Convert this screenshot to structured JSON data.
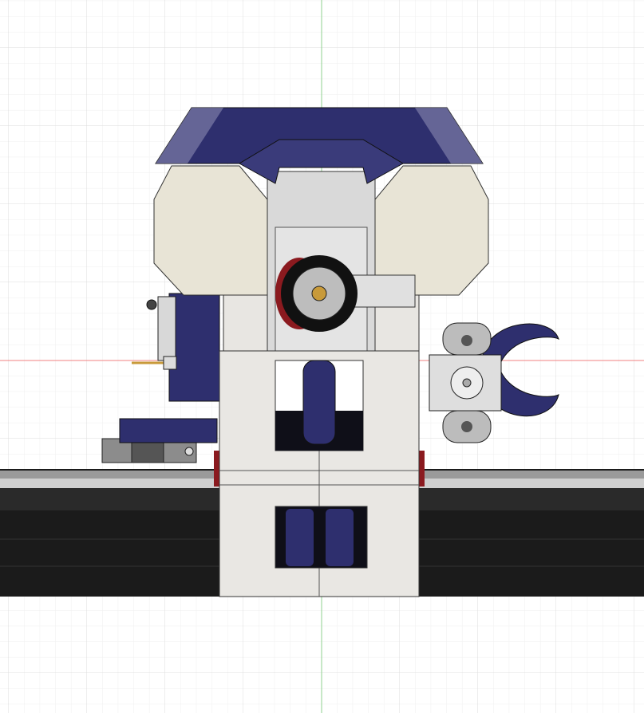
{
  "viewport": {
    "view": "front",
    "background_color": "#ffffff",
    "grid_color": "#e3e3e3",
    "x_axis_color": "#f08080",
    "y_axis_color": "#8fd08f"
  },
  "model": {
    "colors": {
      "body": "#e9e7e3",
      "shell": "#e8e4d6",
      "accent": "#2e2f6e",
      "rail": "#1b1b1b",
      "rail_top": "#c9c9c9",
      "hub": "#111111",
      "brass": "#c89a3a",
      "red": "#8b1a1f"
    }
  }
}
